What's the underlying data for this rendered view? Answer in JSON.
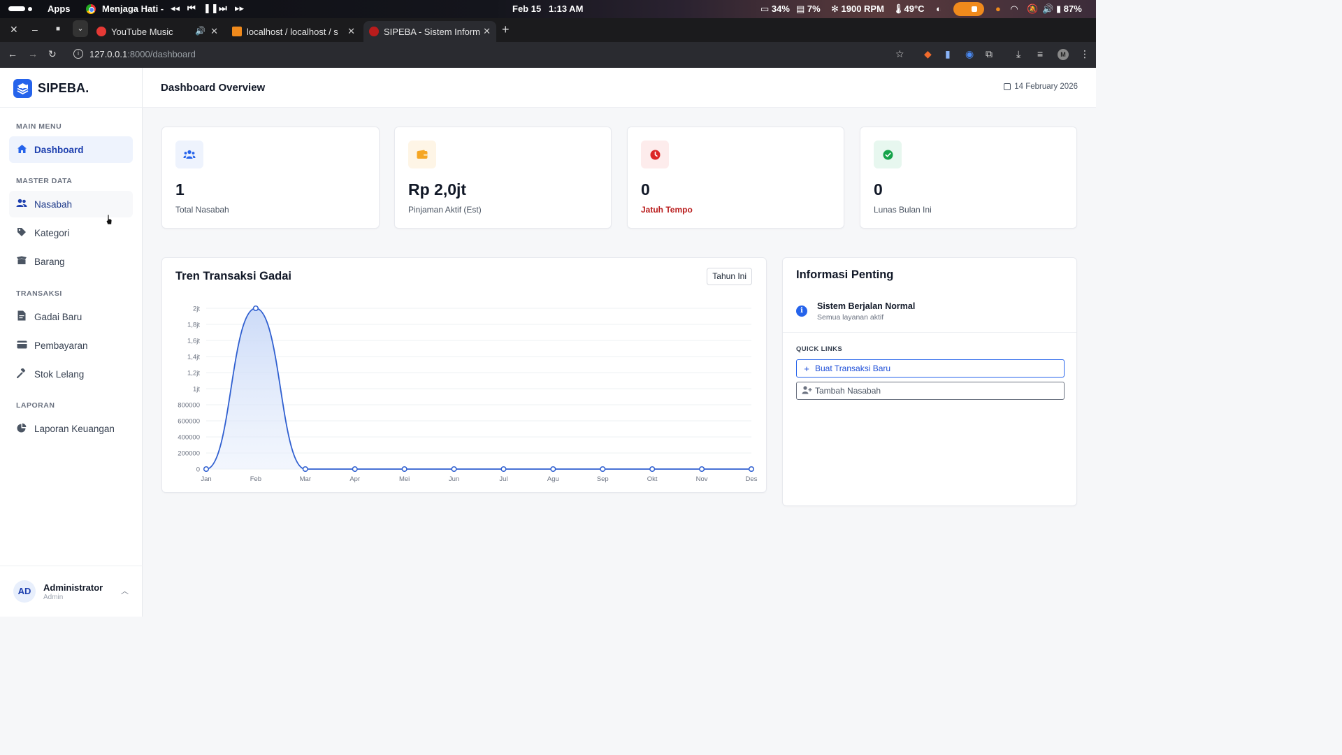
{
  "os_bar": {
    "apps_label": "Apps",
    "media_title": "Menjaga Hati -",
    "date": "Feb 15",
    "time": "1:13 AM",
    "battery_left": "34%",
    "storage": "7%",
    "fan": "1900 RPM",
    "temp": "49°C",
    "battery": "87%"
  },
  "browser": {
    "tabs": [
      {
        "title": "YouTube Music",
        "favicon_color": "#e53935"
      },
      {
        "title": "localhost / localhost / s",
        "favicon_color": "#f08a1c"
      },
      {
        "title": "SIPEBA - Sistem Inform",
        "favicon_color": "#b91c1c"
      }
    ],
    "url_host": "127.0.0.1",
    "url_path": ":8000/dashboard",
    "profile_initial": "M"
  },
  "sidebar": {
    "brand": "SIPEBA.",
    "sections": {
      "main": "MAIN MENU",
      "master": "MASTER DATA",
      "transaksi": "TRANSAKSI",
      "laporan": "LAPORAN"
    },
    "items": {
      "dashboard": "Dashboard",
      "nasabah": "Nasabah",
      "kategori": "Kategori",
      "barang": "Barang",
      "gadai_baru": "Gadai Baru",
      "pembayaran": "Pembayaran",
      "stok_lelang": "Stok Lelang",
      "laporan_keuangan": "Laporan Keuangan"
    },
    "user": {
      "initials": "AD",
      "name": "Administrator",
      "role": "Admin"
    }
  },
  "header": {
    "title": "Dashboard Overview",
    "date": "14 February 2026"
  },
  "stats": [
    {
      "value": "1",
      "label": "Total Nasabah",
      "icon": "users-icon",
      "bg": "#eef3fd",
      "fg": "#2563eb"
    },
    {
      "value": "Rp 2,0jt",
      "label": "Pinjaman Aktif (Est)",
      "icon": "wallet-icon",
      "bg": "#fef5e6",
      "fg": "#f5a623"
    },
    {
      "value": "0",
      "label": "Jatuh Tempo",
      "icon": "clock-icon",
      "bg": "#fdecec",
      "fg": "#dc2626"
    },
    {
      "value": "0",
      "label": "Lunas Bulan Ini",
      "icon": "check-circle-icon",
      "bg": "#e7f7ef",
      "fg": "#16a34a"
    }
  ],
  "chart_card": {
    "title": "Tren Transaksi Gadai",
    "filter": "Tahun Ini"
  },
  "chart_data": {
    "type": "area",
    "categories": [
      "Jan",
      "Feb",
      "Mar",
      "Apr",
      "Mei",
      "Jun",
      "Jul",
      "Agu",
      "Sep",
      "Okt",
      "Nov",
      "Des"
    ],
    "values": [
      0,
      2000000,
      0,
      0,
      0,
      0,
      0,
      0,
      0,
      0,
      0,
      0
    ],
    "ylim": [
      0,
      2000000
    ],
    "yticks": [
      {
        "v": 0,
        "label": "0"
      },
      {
        "v": 200000,
        "label": "200000"
      },
      {
        "v": 400000,
        "label": "400000"
      },
      {
        "v": 600000,
        "label": "600000"
      },
      {
        "v": 800000,
        "label": "800000"
      },
      {
        "v": 1000000,
        "label": "1jt"
      },
      {
        "v": 1200000,
        "label": "1,2jt"
      },
      {
        "v": 1400000,
        "label": "1,4jt"
      },
      {
        "v": 1600000,
        "label": "1,6jt"
      },
      {
        "v": 1800000,
        "label": "1,8jt"
      },
      {
        "v": 2000000,
        "label": "2jt"
      }
    ],
    "color": "#2f5fd0",
    "grid": true
  },
  "info": {
    "title": "Informasi Penting",
    "status_title": "Sistem Berjalan Normal",
    "status_sub": "Semua layanan aktif",
    "quick_links_label": "QUICK LINKS",
    "link_new_tx": "Buat Transaksi Baru",
    "link_add_customer": "Tambah Nasabah"
  }
}
